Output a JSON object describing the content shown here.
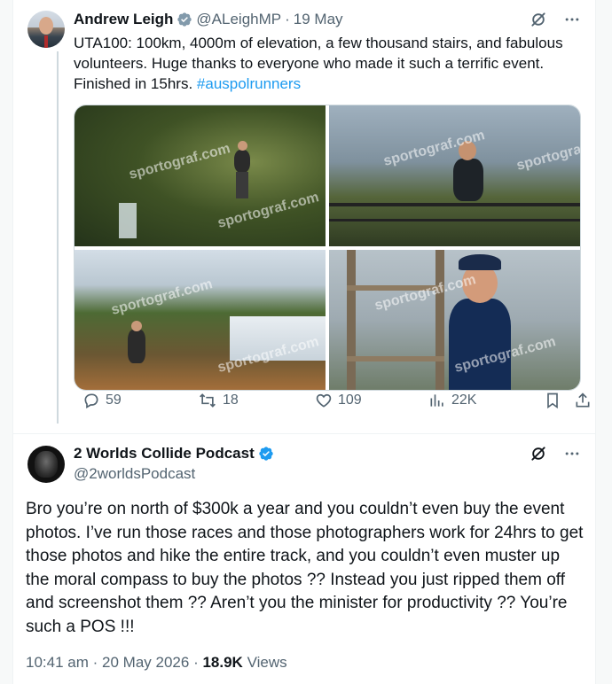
{
  "tweet1": {
    "author_name": "Andrew Leigh",
    "handle": "@ALeighMP",
    "separator": "·",
    "date": "19 May",
    "text": "UTA100: 100km, 4000m of elevation, a few thousand stairs, and fabulous volunteers. Huge thanks to everyone who made it such a terrific event. Finished in 15hrs. ",
    "hashtag": "#auspolrunners",
    "watermark": "sportograf.com",
    "stats": {
      "replies": "59",
      "reposts": "18",
      "likes": "109",
      "views": "22K"
    }
  },
  "tweet2": {
    "author_name": "2 Worlds Collide Podcast",
    "handle": "@2worldsPodcast",
    "text": "Bro you’re on north of $300k a year and you couldn’t even buy the event photos. I’ve run those races and those photographers work for 24hrs to get those photos and hike the entire track, and you couldn’t even muster up the moral compass to buy the photos ?? Instead you just ripped them off and screenshot them ?? Aren’t you the minister for productivity ?? You’re such a POS !!!",
    "time": "10:41 am",
    "separator": "·",
    "date": "20 May 2026",
    "views_count": "18.9K",
    "views_label": "Views"
  },
  "colors": {
    "accent": "#1d9bf0",
    "muted": "#536471",
    "text": "#0f1419"
  },
  "icons": [
    "verified-badge-icon",
    "grok-icon",
    "more-icon",
    "reply-icon",
    "repost-icon",
    "like-icon",
    "views-icon",
    "bookmark-icon",
    "share-icon"
  ]
}
